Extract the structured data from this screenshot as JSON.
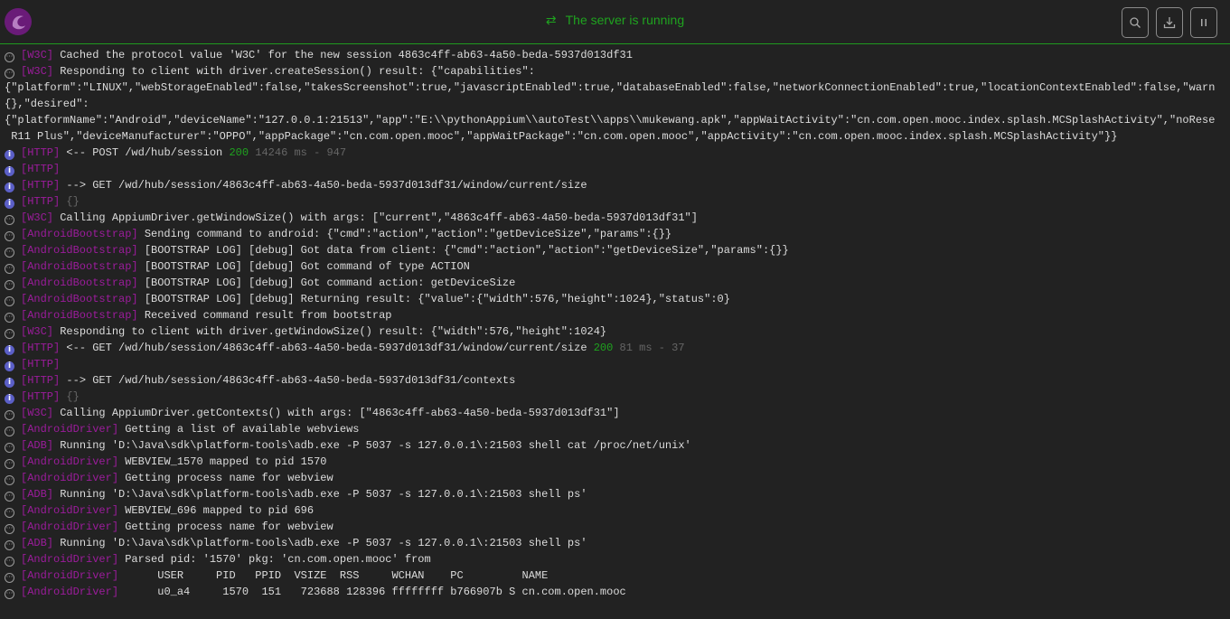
{
  "header": {
    "status_text": "The server is running",
    "status_icon": "sync-icon",
    "buttons": [
      {
        "name": "search-button",
        "icon": "search-icon"
      },
      {
        "name": "download-logs-button",
        "icon": "download-icon"
      },
      {
        "name": "pause-button",
        "icon": "pause-icon"
      }
    ]
  },
  "colors": {
    "accent": "#1fa31f",
    "tag": "#9c1c9c",
    "background": "#222222",
    "info": "#5b5fc7"
  },
  "log": [
    {
      "level": "debug",
      "tag": "[W3C]",
      "text": "Cached the protocol value 'W3C' for the new session 4863c4ff-ab63-4a50-beda-5937d013df31"
    },
    {
      "level": "debug",
      "tag": "[W3C]",
      "wrap": true,
      "text": "Responding to client with driver.createSession() result: {\"capabilities\":\n{\"platform\":\"LINUX\",\"webStorageEnabled\":false,\"takesScreenshot\":true,\"javascriptEnabled\":true,\"databaseEnabled\":false,\"networkConnectionEnabled\":true,\"locationContextEnabled\":false,\"warn\n{},\"desired\":\n{\"platformName\":\"Android\",\"deviceName\":\"127.0.0.1:21513\",\"app\":\"E:\\\\pythonAppium\\\\autoTest\\\\apps\\\\mukewang.apk\",\"appWaitActivity\":\"cn.com.open.mooc.index.splash.MCSplashActivity\",\"noRese\n R11 Plus\",\"deviceManufacturer\":\"OPPO\",\"appPackage\":\"cn.com.open.mooc\",\"appWaitPackage\":\"cn.com.open.mooc\",\"appActivity\":\"cn.com.open.mooc.index.splash.MCSplashActivity\"}}"
    },
    {
      "level": "info",
      "tag": "[HTTP]",
      "text": "<-- POST /wd/hub/session",
      "code": "200",
      "meta": "14246 ms - 947"
    },
    {
      "level": "info",
      "tag": "[HTTP]",
      "text": ""
    },
    {
      "level": "info",
      "tag": "[HTTP]",
      "text": "--> GET /wd/hub/session/4863c4ff-ab63-4a50-beda-5937d013df31/window/current/size"
    },
    {
      "level": "info",
      "tag": "[HTTP]",
      "muted": "{}"
    },
    {
      "level": "debug",
      "tag": "[W3C]",
      "text": "Calling AppiumDriver.getWindowSize() with args: [\"current\",\"4863c4ff-ab63-4a50-beda-5937d013df31\"]"
    },
    {
      "level": "debug",
      "tag": "[AndroidBootstrap]",
      "text": "Sending command to android: {\"cmd\":\"action\",\"action\":\"getDeviceSize\",\"params\":{}}"
    },
    {
      "level": "debug",
      "tag": "[AndroidBootstrap]",
      "text": "[BOOTSTRAP LOG] [debug] Got data from client: {\"cmd\":\"action\",\"action\":\"getDeviceSize\",\"params\":{}}"
    },
    {
      "level": "debug",
      "tag": "[AndroidBootstrap]",
      "text": "[BOOTSTRAP LOG] [debug] Got command of type ACTION"
    },
    {
      "level": "debug",
      "tag": "[AndroidBootstrap]",
      "text": "[BOOTSTRAP LOG] [debug] Got command action: getDeviceSize"
    },
    {
      "level": "debug",
      "tag": "[AndroidBootstrap]",
      "text": "[BOOTSTRAP LOG] [debug] Returning result: {\"value\":{\"width\":576,\"height\":1024},\"status\":0}"
    },
    {
      "level": "debug",
      "tag": "[AndroidBootstrap]",
      "text": "Received command result from bootstrap"
    },
    {
      "level": "debug",
      "tag": "[W3C]",
      "text": "Responding to client with driver.getWindowSize() result: {\"width\":576,\"height\":1024}"
    },
    {
      "level": "info",
      "tag": "[HTTP]",
      "text": "<-- GET /wd/hub/session/4863c4ff-ab63-4a50-beda-5937d013df31/window/current/size",
      "code": "200",
      "meta": "81 ms - 37"
    },
    {
      "level": "info",
      "tag": "[HTTP]",
      "text": ""
    },
    {
      "level": "info",
      "tag": "[HTTP]",
      "text": "--> GET /wd/hub/session/4863c4ff-ab63-4a50-beda-5937d013df31/contexts"
    },
    {
      "level": "info",
      "tag": "[HTTP]",
      "muted": "{}"
    },
    {
      "level": "debug",
      "tag": "[W3C]",
      "text": "Calling AppiumDriver.getContexts() with args: [\"4863c4ff-ab63-4a50-beda-5937d013df31\"]"
    },
    {
      "level": "debug",
      "tag": "[AndroidDriver]",
      "text": "Getting a list of available webviews"
    },
    {
      "level": "debug",
      "tag": "[ADB]",
      "text": "Running 'D:\\Java\\sdk\\platform-tools\\adb.exe -P 5037 -s 127.0.0.1\\:21503 shell cat /proc/net/unix'"
    },
    {
      "level": "debug",
      "tag": "[AndroidDriver]",
      "text": "WEBVIEW_1570 mapped to pid 1570"
    },
    {
      "level": "debug",
      "tag": "[AndroidDriver]",
      "text": "Getting process name for webview"
    },
    {
      "level": "debug",
      "tag": "[ADB]",
      "text": "Running 'D:\\Java\\sdk\\platform-tools\\adb.exe -P 5037 -s 127.0.0.1\\:21503 shell ps'"
    },
    {
      "level": "debug",
      "tag": "[AndroidDriver]",
      "text": "WEBVIEW_696 mapped to pid 696"
    },
    {
      "level": "debug",
      "tag": "[AndroidDriver]",
      "text": "Getting process name for webview"
    },
    {
      "level": "debug",
      "tag": "[ADB]",
      "text": "Running 'D:\\Java\\sdk\\platform-tools\\adb.exe -P 5037 -s 127.0.0.1\\:21503 shell ps'"
    },
    {
      "level": "debug",
      "tag": "[AndroidDriver]",
      "text": "Parsed pid: '1570' pkg: 'cn.com.open.mooc' from"
    },
    {
      "level": "debug",
      "tag": "[AndroidDriver]",
      "text": "     USER     PID   PPID  VSIZE  RSS     WCHAN    PC         NAME"
    },
    {
      "level": "debug",
      "tag": "[AndroidDriver]",
      "text": "     u0_a4     1570  151   723688 128396 ffffffff b766907b S cn.com.open.mooc"
    }
  ]
}
